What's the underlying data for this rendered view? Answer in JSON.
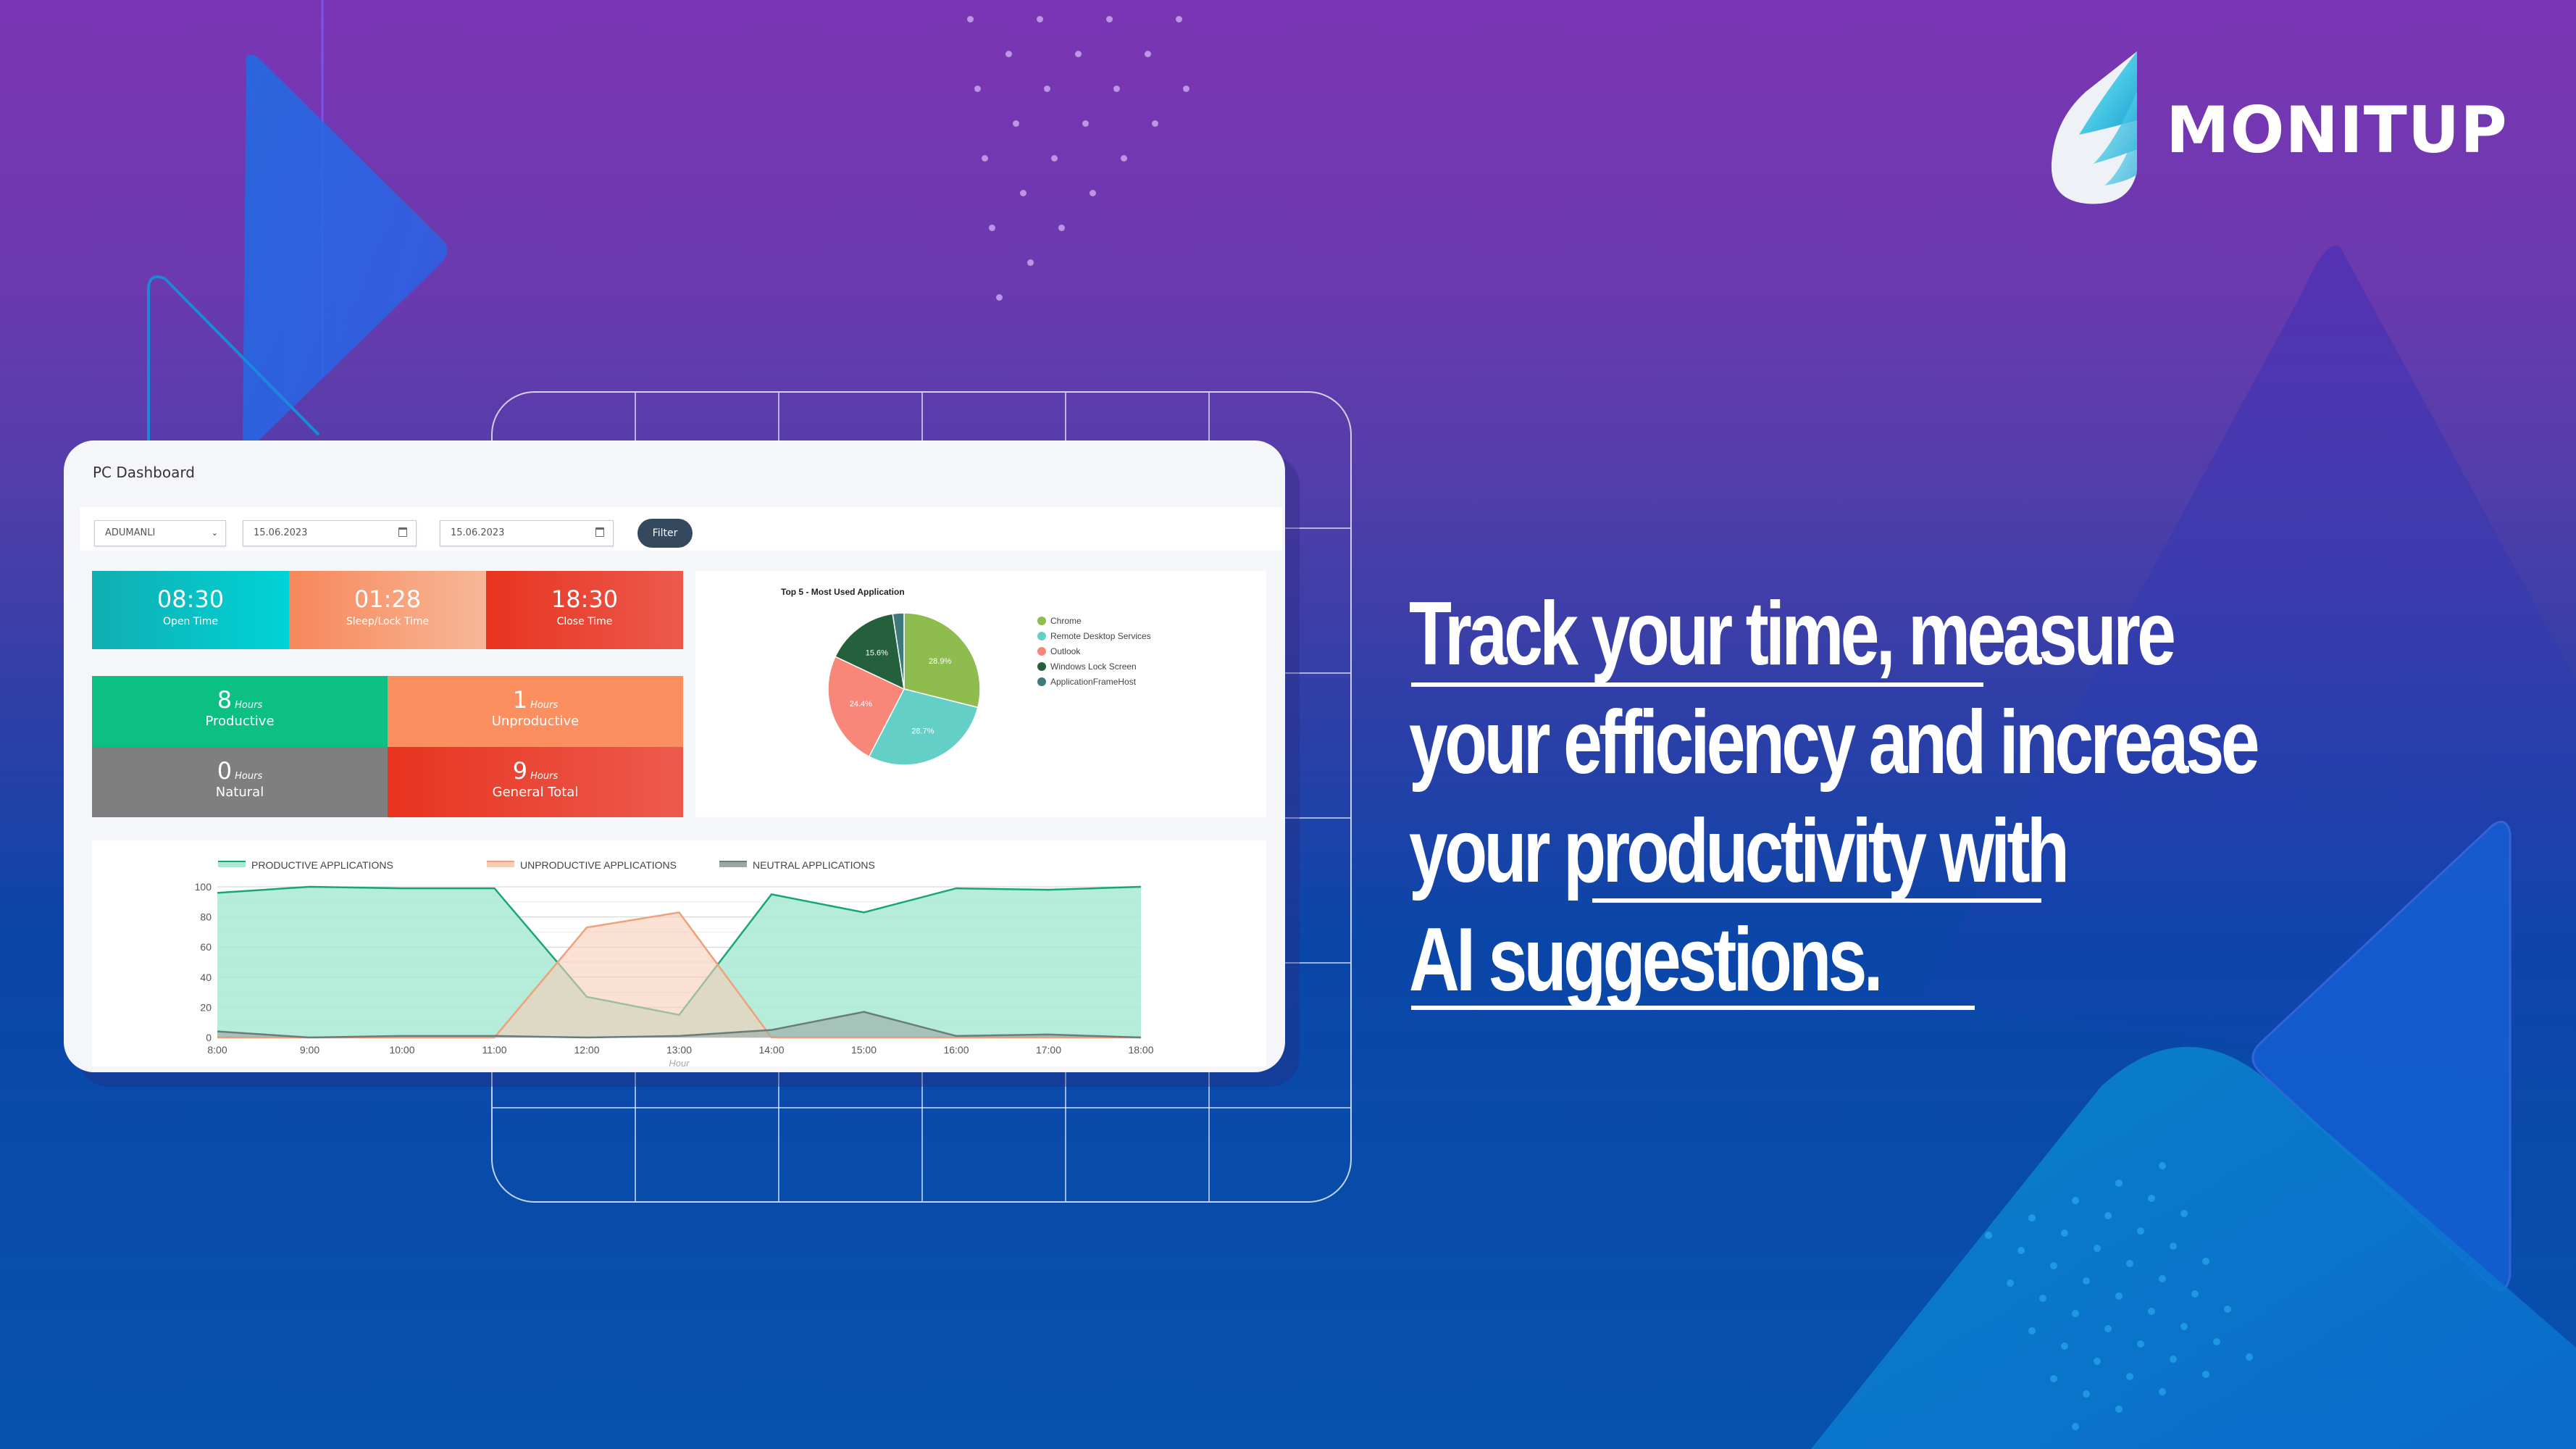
{
  "brand": {
    "name": "MONITUP",
    "logo_icon": "wing-icon"
  },
  "headline": {
    "lines": [
      "Track your time, measure",
      "your efficiency and increase",
      "your productivity with",
      "AI suggestions."
    ],
    "underlined_phrases": [
      "Track your time",
      "productivity",
      "AI suggestions."
    ]
  },
  "dashboard": {
    "title": "PC Dashboard",
    "filters": {
      "user_select": {
        "value": "ADUMANLI"
      },
      "start_date": {
        "value": "15.06.2023",
        "icon": "calendar-icon"
      },
      "end_date": {
        "value": "15.06.2023",
        "icon": "calendar-icon"
      },
      "filter_button": "Filter"
    },
    "kpis": [
      {
        "value": "08:30",
        "label": "Open Time",
        "color": "#10aeb2"
      },
      {
        "value": "01:28",
        "label": "Sleep/Lock Time",
        "color": "#f7875a"
      },
      {
        "value": "18:30",
        "label": "Close Time",
        "color": "#e8341f"
      }
    ],
    "hours": {
      "unit": "Hours",
      "items": [
        {
          "value": "8",
          "label": "Productive",
          "color": "#0cbf83"
        },
        {
          "value": "1",
          "label": "Unproductive",
          "color": "#fb8f60"
        },
        {
          "value": "0",
          "label": "Natural",
          "color": "#7f7f7f"
        },
        {
          "value": "9",
          "label": "General Total",
          "color": "#e8341f"
        }
      ]
    }
  },
  "chart_data": [
    {
      "type": "pie",
      "title": "Top 5 - Most Used Application",
      "legend_position": "right",
      "slices": [
        {
          "label": "Chrome",
          "value": 28.9,
          "display": "28.9%",
          "color": "#8fbc4f"
        },
        {
          "label": "Remote Desktop Services",
          "value": 28.7,
          "display": "28.7%",
          "color": "#63cfc7"
        },
        {
          "label": "Outlook",
          "value": 24.4,
          "display": "24.4%",
          "color": "#f8877a"
        },
        {
          "label": "Windows Lock Screen",
          "value": 15.6,
          "display": "15.6%",
          "color": "#23603b"
        },
        {
          "label": "ApplicationFrameHost",
          "value": 2.4,
          "display": "",
          "color": "#3e7a7c"
        }
      ]
    },
    {
      "type": "area",
      "title": "",
      "xlabel": "Hour",
      "ylabel": "",
      "ylim": [
        0,
        100
      ],
      "yticks": [
        0,
        20,
        40,
        60,
        80,
        100
      ],
      "grid": true,
      "legend_position": "top",
      "categories": [
        "8:00",
        "9:00",
        "10:00",
        "11:00",
        "12:00",
        "13:00",
        "14:00",
        "15:00",
        "16:00",
        "17:00",
        "18:00"
      ],
      "series": [
        {
          "name": "PRODUCTIVE APPLICATIONS",
          "color": "#19a57a",
          "fill": "#a9e9d3",
          "values": [
            96,
            100,
            99,
            99,
            27,
            15,
            95,
            83,
            99,
            98,
            100
          ]
        },
        {
          "name": "UNPRODUCTIVE APPLICATIONS",
          "color": "#f0a07a",
          "fill": "#f8cdb8",
          "values": [
            0,
            0,
            0,
            0,
            73,
            83,
            0,
            0,
            0,
            0,
            0
          ]
        },
        {
          "name": "NEUTRAL APPLICATIONS",
          "color": "#6b7d78",
          "fill": "#9aa8a3",
          "values": [
            4,
            0,
            1,
            1,
            0,
            1,
            5,
            17,
            1,
            2,
            0
          ]
        }
      ]
    }
  ]
}
